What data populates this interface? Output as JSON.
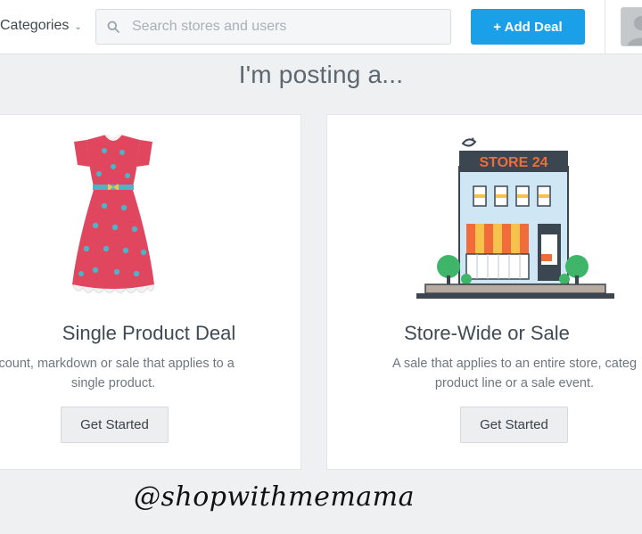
{
  "header": {
    "categories_label": "Categories",
    "search_placeholder": "Search stores and users",
    "add_deal_label": "+ Add Deal"
  },
  "main": {
    "title": "I'm posting a...",
    "cards": [
      {
        "title": "Single Product Deal",
        "description_lines": [
          "scount, markdown or sale that applies to a",
          "single product."
        ],
        "button_label": "Get Started"
      },
      {
        "title": "Store-Wide or Sale",
        "sign_text": "STORE 24",
        "description_lines": [
          "A sale that applies to an entire store, categ",
          "product line or a sale event."
        ],
        "button_label": "Get Started"
      }
    ]
  },
  "watermark": "@shopwithmemama",
  "colors": {
    "accent": "#1aa0e8",
    "dress": "#e0475f",
    "store_sign": "#f26b3a"
  },
  "icons": [
    "chevron-down-icon",
    "search-icon",
    "avatar",
    "dress-illustration",
    "store-illustration"
  ]
}
